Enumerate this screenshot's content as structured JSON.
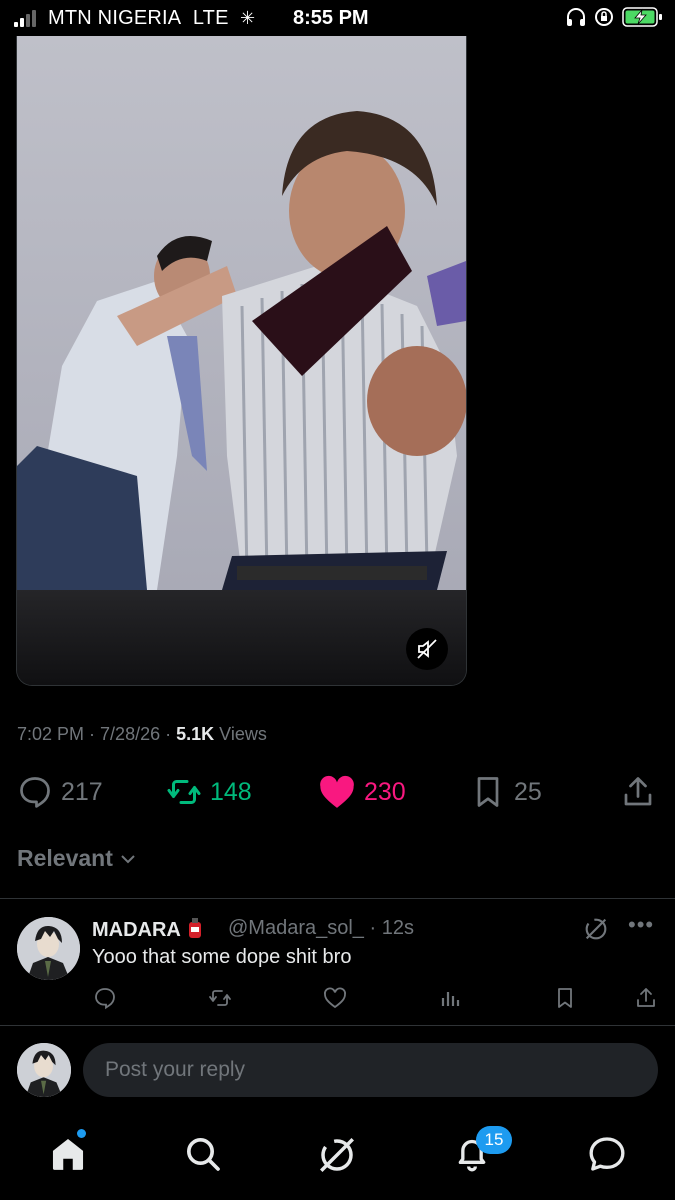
{
  "status_bar": {
    "carrier": "MTN NIGERIA",
    "network": "LTE",
    "time": "8:55 PM"
  },
  "tweet": {
    "time": "7:02 PM",
    "date": "7/28/26",
    "views_count": "5.1K",
    "views_label": "Views",
    "replies": "217",
    "reposts": "148",
    "likes": "230",
    "bookmarks": "25"
  },
  "sort": {
    "label": "Relevant"
  },
  "reply": {
    "name": "MADARA",
    "handle": "@Madara_sol_",
    "time": "12s",
    "text": "Yooo that some dope shit bro"
  },
  "composer": {
    "placeholder": "Post your reply"
  },
  "bottom_nav": {
    "notifications_badge": "15",
    "items": [
      "home-icon",
      "search-icon",
      "grok-icon",
      "notifications-icon",
      "messages-icon"
    ]
  },
  "colors": {
    "accent": "#1d9bf0",
    "like": "#f91880",
    "repost": "#00ba7c",
    "muted": "#71767b"
  }
}
